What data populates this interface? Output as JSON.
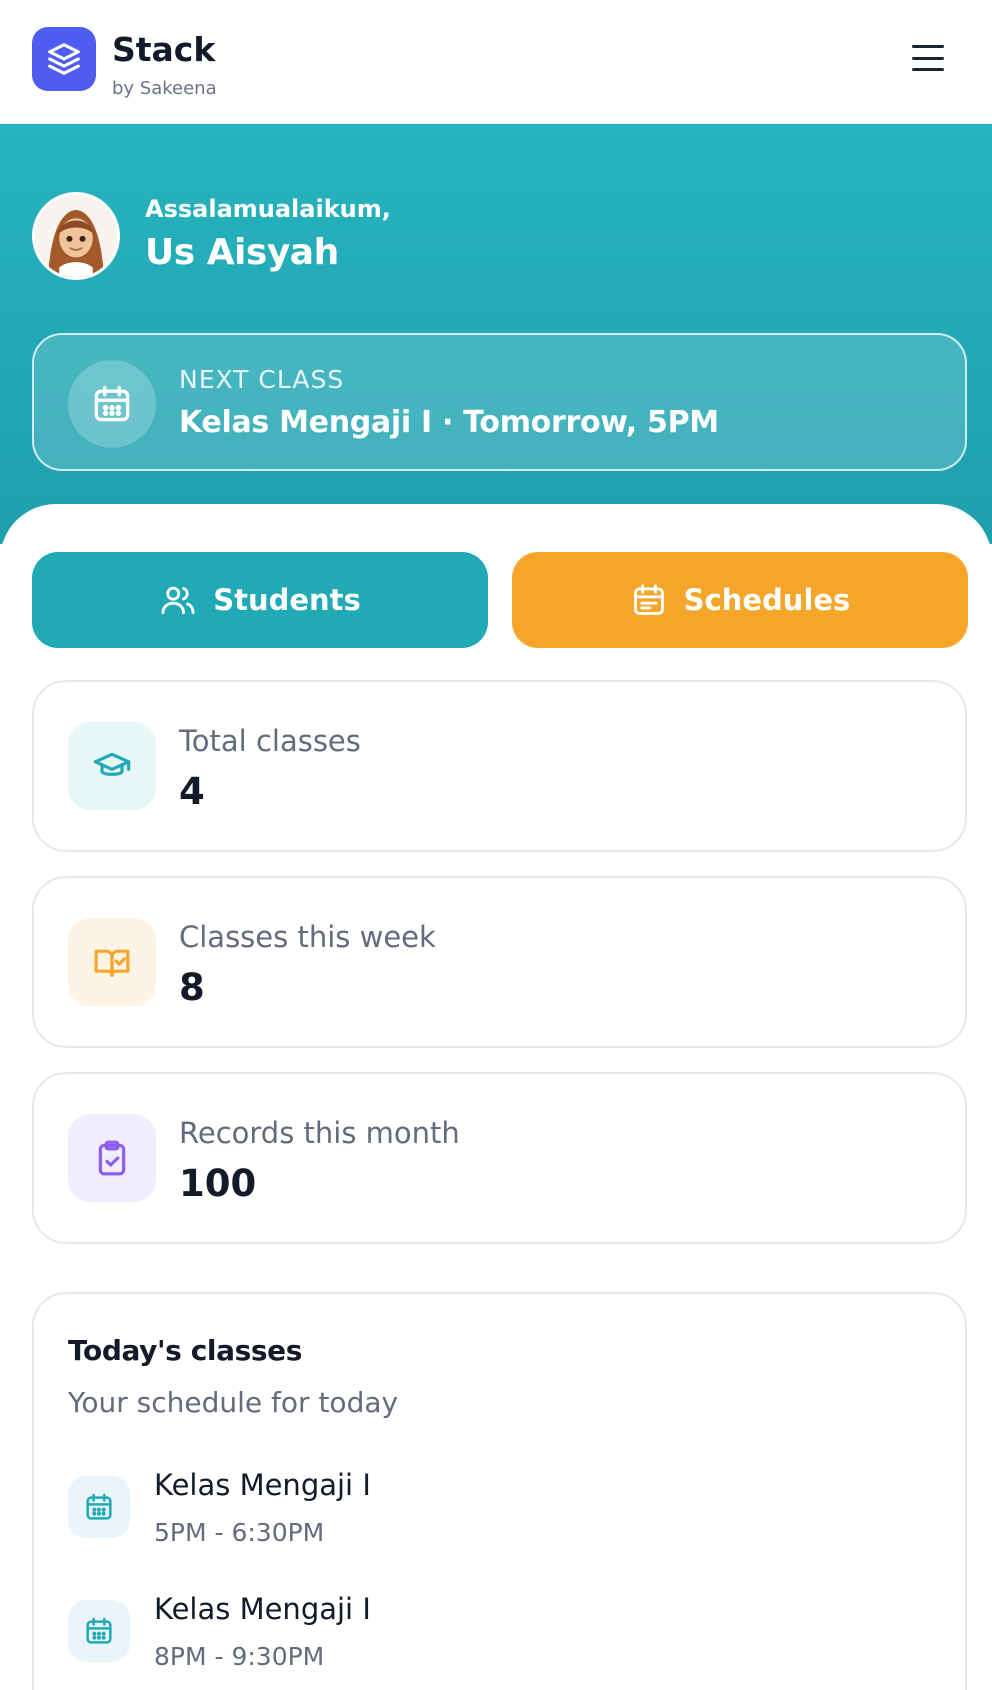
{
  "app": {
    "name": "Stack",
    "by_line": "by Sakeena",
    "logo_icon": "stack-layers-icon",
    "menu_icon": "hamburger-menu-icon"
  },
  "colors": {
    "brand": "#4f5cf0",
    "teal": "#21aab5",
    "orange": "#f4a62a",
    "purple": "#8b5cf6"
  },
  "hero": {
    "greeting": "Assalamualaikum,",
    "user_name": "Us Aisyah",
    "next_class": {
      "label": "NEXT CLASS",
      "value": "Kelas Mengaji I · Tomorrow, 5PM",
      "icon": "calendar-icon"
    }
  },
  "actions": {
    "students": {
      "label": "Students",
      "icon": "users-icon"
    },
    "schedules": {
      "label": "Schedules",
      "icon": "calendar-list-icon"
    }
  },
  "stats": [
    {
      "label": "Total classes",
      "value": "4",
      "icon": "graduation-cap-icon"
    },
    {
      "label": "Classes this week",
      "value": "8",
      "icon": "book-check-icon"
    },
    {
      "label": "Records this month",
      "value": "100",
      "icon": "clipboard-check-icon"
    }
  ],
  "today": {
    "title": "Today's classes",
    "subtitle": "Your schedule for today",
    "classes": [
      {
        "name": "Kelas Mengaji I",
        "time": "5PM - 6:30PM",
        "icon": "calendar-icon"
      },
      {
        "name": "Kelas Mengaji I",
        "time": "8PM - 9:30PM",
        "icon": "calendar-icon"
      }
    ]
  }
}
